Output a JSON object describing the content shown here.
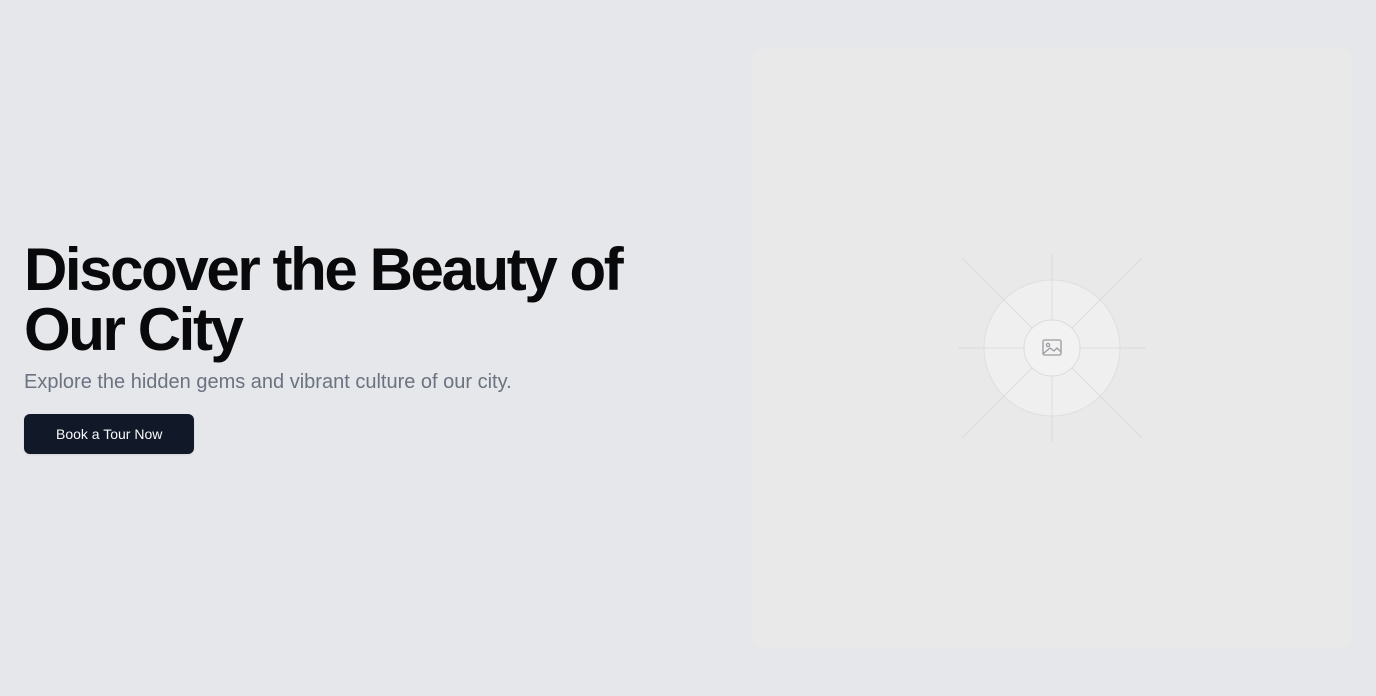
{
  "hero": {
    "headline_line1": "Discover the Beauty of",
    "headline_line2": "Our City",
    "subtitle": "Explore the hidden gems and vibrant culture of our city.",
    "cta_label": "Book a Tour Now"
  },
  "media": {
    "icon": "image-icon"
  },
  "colors": {
    "background": "#e5e7eb",
    "heading": "#09090b",
    "subtitle": "#6b7280",
    "button_bg": "#111827",
    "button_text": "#f9fafb",
    "media_bg": "#e9e9ea"
  }
}
